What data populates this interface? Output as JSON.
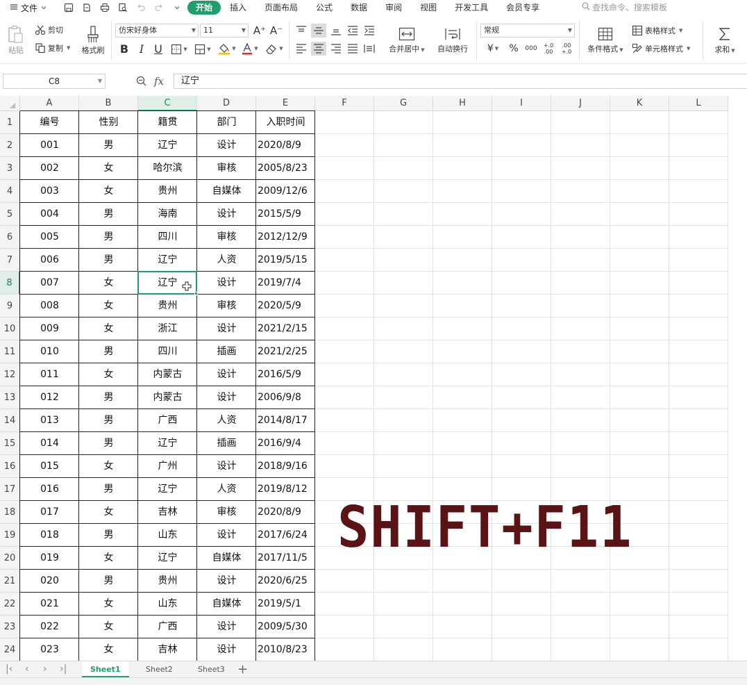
{
  "menubar": {
    "file_label": "文件",
    "tabs": [
      "开始",
      "插入",
      "页面布局",
      "公式",
      "数据",
      "审阅",
      "视图",
      "开发工具",
      "会员专享"
    ],
    "active_tab": "开始",
    "search_placeholder": "查找命令、搜索模板"
  },
  "ribbon": {
    "paste": "粘贴",
    "cut": "剪切",
    "copy": "复制",
    "format_painter": "格式刷",
    "font_name": "仿宋好身体",
    "font_size": "11",
    "merge_center": "合并居中",
    "wrap_text": "自动换行",
    "number_format": "常规",
    "conditional_format": "条件格式",
    "table_style": "表格样式",
    "cell_style": "单元格样式",
    "sum": "求和",
    "bold": "B",
    "italic": "I",
    "underline": "U",
    "currency": "¥",
    "percent": "%",
    "thousands": "000",
    "inc_decimal": "+.0 .00",
    "dec_decimal": ".00 +.0"
  },
  "formula": {
    "cell_ref": "C8",
    "fx": "fx",
    "value": "辽宁"
  },
  "columns": [
    "A",
    "B",
    "C",
    "D",
    "E",
    "F",
    "G",
    "H",
    "I",
    "J",
    "K",
    "L"
  ],
  "selected_column": "C",
  "selected_row": 8,
  "header": [
    "编号",
    "性别",
    "籍贯",
    "部门",
    "入职时间"
  ],
  "rows": [
    [
      "001",
      "男",
      "辽宁",
      "设计",
      "2020/8/9"
    ],
    [
      "002",
      "女",
      "哈尔滨",
      "审核",
      "2005/8/23"
    ],
    [
      "003",
      "女",
      "贵州",
      "自媒体",
      "2009/12/6"
    ],
    [
      "004",
      "男",
      "海南",
      "设计",
      "2015/5/9"
    ],
    [
      "005",
      "男",
      "四川",
      "审核",
      "2012/12/9"
    ],
    [
      "006",
      "男",
      "辽宁",
      "人资",
      "2019/5/15"
    ],
    [
      "007",
      "女",
      "辽宁",
      "设计",
      "2019/7/4"
    ],
    [
      "008",
      "女",
      "贵州",
      "审核",
      "2020/5/9"
    ],
    [
      "009",
      "女",
      "浙江",
      "设计",
      "2021/2/15"
    ],
    [
      "010",
      "男",
      "四川",
      "插画",
      "2021/2/25"
    ],
    [
      "011",
      "女",
      "内蒙古",
      "设计",
      "2016/5/9"
    ],
    [
      "012",
      "男",
      "内蒙古",
      "设计",
      "2006/9/8"
    ],
    [
      "013",
      "男",
      "广西",
      "人资",
      "2014/8/17"
    ],
    [
      "014",
      "男",
      "辽宁",
      "插画",
      "2016/9/4"
    ],
    [
      "015",
      "女",
      "广州",
      "设计",
      "2018/9/16"
    ],
    [
      "016",
      "男",
      "辽宁",
      "人资",
      "2019/8/12"
    ],
    [
      "017",
      "女",
      "吉林",
      "审核",
      "2020/8/9"
    ],
    [
      "018",
      "男",
      "山东",
      "设计",
      "2017/6/24"
    ],
    [
      "019",
      "女",
      "辽宁",
      "自媒体",
      "2017/11/5"
    ],
    [
      "020",
      "男",
      "贵州",
      "设计",
      "2020/6/25"
    ],
    [
      "021",
      "女",
      "山东",
      "自媒体",
      "2019/5/1"
    ],
    [
      "022",
      "女",
      "广西",
      "设计",
      "2009/5/30"
    ],
    [
      "023",
      "女",
      "吉林",
      "设计",
      "2010/8/23"
    ]
  ],
  "overlay_text": "SHIFT+F11",
  "sheets": [
    "Sheet1",
    "Sheet2",
    "Sheet3"
  ],
  "active_sheet": "Sheet1",
  "colors": {
    "accent": "#1f9f6b",
    "overlay": "#5a1416",
    "header_bg": "#f4f4f4"
  },
  "icons": [
    "save-icon",
    "undo-icon",
    "redo-icon",
    "print-icon",
    "paste-icon",
    "scissors-icon",
    "copy-icon",
    "brush-icon",
    "search-icon",
    "zoom-icon",
    "sum-icon"
  ]
}
